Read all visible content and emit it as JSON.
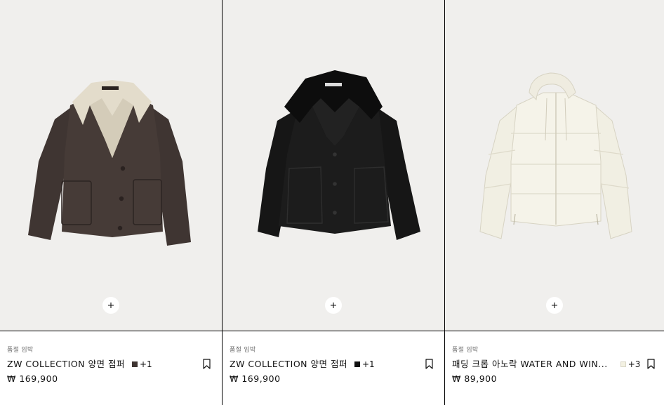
{
  "products": [
    {
      "tag": "품절 임박",
      "name": "ZW COLLECTION 양면 점퍼",
      "swatch_color": "#3e3431",
      "swatch_more": "+1",
      "price": "₩ 169,900",
      "image_icon": "brown-shearling-jacket",
      "add_icon": "plus-icon",
      "save_icon": "bookmark-icon"
    },
    {
      "tag": "품절 임박",
      "name": "ZW COLLECTION 양면 점퍼",
      "swatch_color": "#111111",
      "swatch_more": "+1",
      "price": "₩ 169,900",
      "image_icon": "black-shearling-jacket",
      "add_icon": "plus-icon",
      "save_icon": "bookmark-icon"
    },
    {
      "tag": "품절 임박",
      "name": "패딩 크롭 아노락 WATER AND WIN...",
      "swatch_color": "#f3f1e2",
      "swatch_more": "+3",
      "price": "₩ 89,900",
      "image_icon": "cream-puffer-jacket",
      "add_icon": "plus-icon",
      "save_icon": "bookmark-icon"
    }
  ]
}
